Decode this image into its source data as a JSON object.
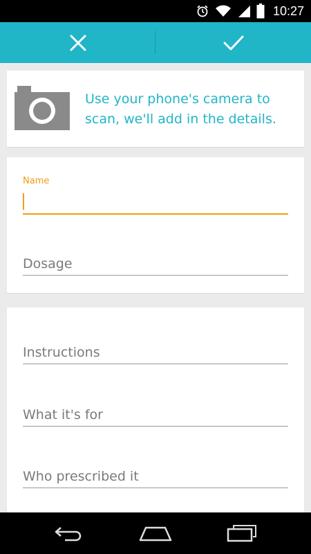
{
  "status_bar": {
    "time": "10:27"
  },
  "toolbar": {
    "cancel_icon": "close-icon",
    "confirm_icon": "check-icon",
    "accent": "#21b5c8"
  },
  "scan_card": {
    "icon": "camera-icon",
    "text": "Use your phone's camera to scan, we'll add in the details."
  },
  "form_basic": {
    "name": {
      "label": "Name",
      "value": ""
    },
    "dosage": {
      "placeholder": "Dosage"
    }
  },
  "form_details": {
    "instructions": {
      "placeholder": "Instructions"
    },
    "purpose": {
      "placeholder": "What it's for"
    },
    "prescriber": {
      "placeholder": "Who prescribed it"
    }
  },
  "nav_bar": {
    "back_icon": "back-icon",
    "home_icon": "home-icon",
    "recents_icon": "recents-icon"
  }
}
